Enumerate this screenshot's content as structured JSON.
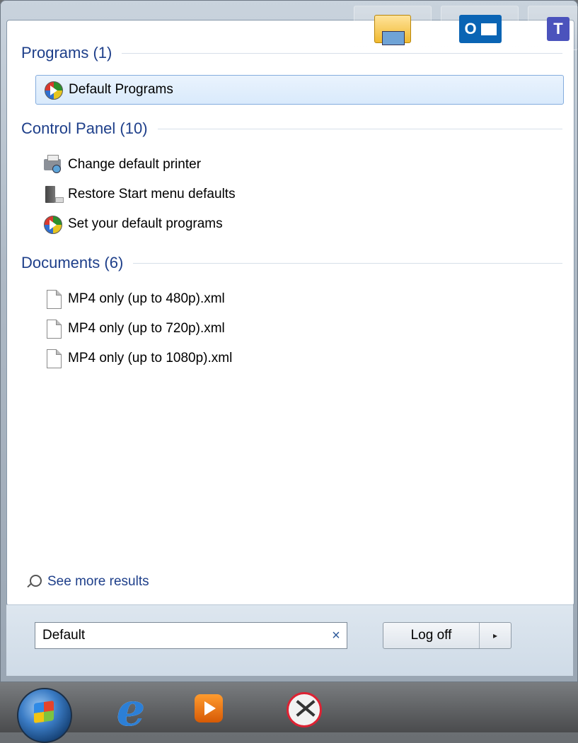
{
  "programs": {
    "header": "Programs (1)",
    "items": [
      {
        "label": "Default Programs",
        "icon": "default-programs-icon"
      }
    ]
  },
  "control_panel": {
    "header": "Control Panel (10)",
    "items": [
      {
        "label": "Change default printer",
        "icon": "printer-icon"
      },
      {
        "label": "Restore Start menu defaults",
        "icon": "computer-tower-icon"
      },
      {
        "label": "Set your default programs",
        "icon": "default-programs-icon"
      }
    ]
  },
  "documents": {
    "header": "Documents (6)",
    "items": [
      {
        "label": "MP4 only (up to 480p).xml",
        "icon": "document-icon"
      },
      {
        "label": "MP4 only (up to 720p).xml",
        "icon": "document-icon"
      },
      {
        "label": "MP4 only (up to 1080p).xml",
        "icon": "document-icon"
      }
    ]
  },
  "see_more": "See more results",
  "search": {
    "value": "Default",
    "clear": "×"
  },
  "logoff": {
    "label": "Log off",
    "arrow": "▸"
  },
  "taskbar": {
    "items": [
      "start-orb",
      "internet-explorer-icon",
      "media-player-icon",
      "snipping-tool-icon",
      "file-explorer-icon",
      "outlook-icon",
      "teams-icon"
    ],
    "outlook_glyph": "O",
    "teams_glyph": "T",
    "ie_glyph": "e"
  },
  "colors": {
    "header": "#1e3f8a",
    "selected_bg": "#d9eafc",
    "selected_border": "#84acdd"
  }
}
